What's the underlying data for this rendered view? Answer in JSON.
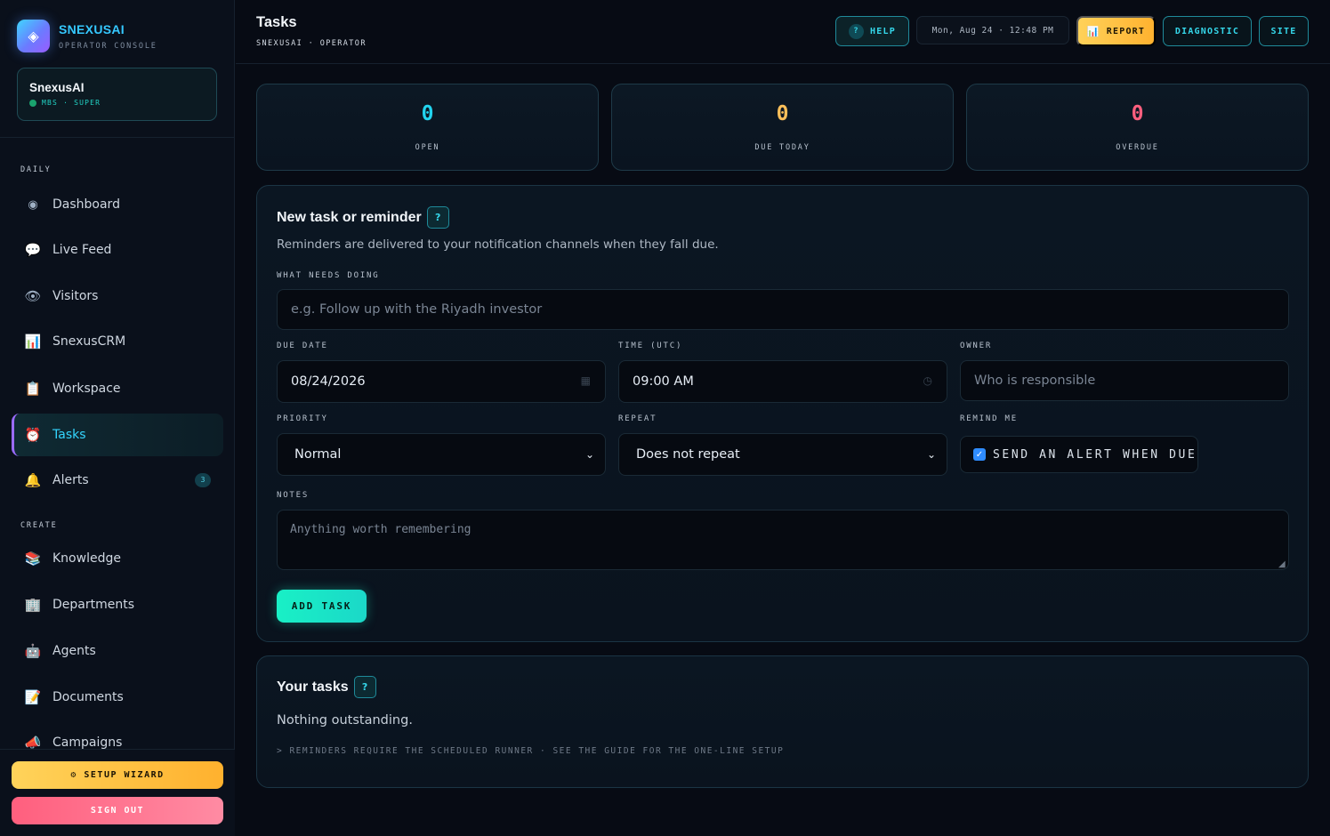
{
  "brand": {
    "logo_glyph": "◈",
    "name": "SNEXUSAI",
    "subtitle": "OPERATOR CONSOLE"
  },
  "account": {
    "name": "SnexusAI",
    "role": "MBS · SUPER",
    "status_color": "#1aa36e"
  },
  "sidebar": {
    "sections": [
      {
        "label": "DAILY"
      },
      {
        "label": "CREATE"
      }
    ],
    "items": [
      {
        "icon": "◉",
        "icon_name": "dashboard-icon",
        "label": "Dashboard"
      },
      {
        "icon": "💬",
        "icon_name": "speech-bubble-icon",
        "label": "Live Feed"
      },
      {
        "icon": "👁",
        "icon_name": "eye-icon",
        "label": "Visitors"
      },
      {
        "icon": "📊",
        "icon_name": "bar-chart-icon",
        "label": "SnexusCRM"
      },
      {
        "icon": "📋",
        "icon_name": "clipboard-icon",
        "label": "Workspace"
      },
      {
        "icon": "⏰",
        "icon_name": "alarm-clock-icon",
        "label": "Tasks",
        "active": true
      },
      {
        "icon": "🔔",
        "icon_name": "bell-icon",
        "label": "Alerts",
        "badge": "3"
      },
      {
        "icon": "📚",
        "icon_name": "books-icon",
        "label": "Knowledge"
      },
      {
        "icon": "🏢",
        "icon_name": "office-building-icon",
        "label": "Departments"
      },
      {
        "icon": "🤖",
        "icon_name": "robot-icon",
        "label": "Agents"
      },
      {
        "icon": "📝",
        "icon_name": "memo-icon",
        "label": "Documents"
      },
      {
        "icon": "📣",
        "icon_name": "megaphone-icon",
        "label": "Campaigns"
      }
    ],
    "setup_wizard": "⚙ SETUP WIZARD",
    "sign_out": "SIGN OUT"
  },
  "header": {
    "title": "Tasks",
    "breadcrumb": "SNEXUSAI · OPERATOR",
    "help_icon": "?",
    "help_label": "HELP",
    "clock": "Mon, Aug 24 · 12:48 PM",
    "report_icon": "📊",
    "report_label": "REPORT",
    "diagnostic_label": "DIAGNOSTIC",
    "site_label": "SITE"
  },
  "stats": [
    {
      "value": "0",
      "label": "OPEN",
      "color": "#22d3ee"
    },
    {
      "value": "0",
      "label": "DUE TODAY",
      "color": "#fbbf5a"
    },
    {
      "value": "0",
      "label": "OVERDUE",
      "color": "#ff5f7e"
    }
  ],
  "new_task": {
    "title": "New task or reminder",
    "help_icon": "?",
    "description": "Reminders are delivered to your notification channels when they fall due.",
    "task_label": "WHAT NEEDS DOING",
    "task_placeholder": "e.g. Follow up with the Riyadh investor",
    "due_label": "DUE DATE",
    "due_value": "08/24/2026",
    "time_label": "TIME (UTC)",
    "time_value": "09:00 AM",
    "owner_label": "OWNER",
    "owner_placeholder": "Who is responsible",
    "priority_label": "PRIORITY",
    "priority_value": "Normal",
    "repeat_label": "REPEAT",
    "repeat_value": "Does not repeat",
    "remind_label": "REMIND ME",
    "remind_text": "SEND AN ALERT WHEN DUE",
    "remind_checked": true,
    "notes_label": "NOTES",
    "notes_placeholder": "Anything worth remembering",
    "add_button": "ADD TASK"
  },
  "tasks_panel": {
    "title": "Your tasks",
    "help_icon": "?",
    "empty_text": "Nothing outstanding.",
    "hint": "> REMINDERS REQUIRE THE SCHEDULED RUNNER · SEE THE GUIDE FOR THE ONE-LINE SETUP"
  }
}
